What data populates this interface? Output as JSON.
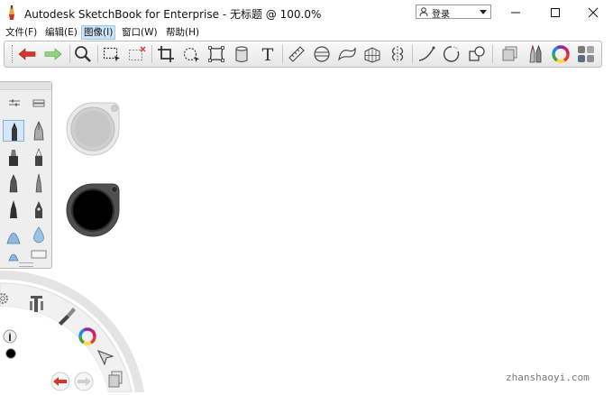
{
  "window": {
    "title": "Autodesk SketchBook for Enterprise - 无标题 @ 100.0%",
    "login_label": "登录"
  },
  "menu": [
    {
      "label": "文件(F)"
    },
    {
      "label": "编辑(E)"
    },
    {
      "label": "图像(I)"
    },
    {
      "label": "窗口(W)"
    },
    {
      "label": "帮助(H)"
    }
  ],
  "toolbar": {
    "text_tool_glyph": "T"
  },
  "colors": {
    "undo_red": "#d9362b",
    "redo_green": "#6cbf5c",
    "toolbar_bg": "#ececec",
    "selected_brush": "#d4e6f8",
    "menu_active": "#cce4f7"
  },
  "watermark": "zhanshaoyi.com"
}
